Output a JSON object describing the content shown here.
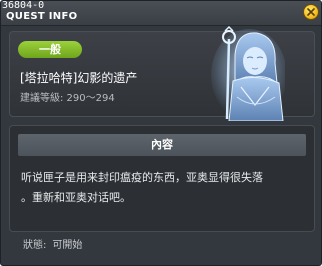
{
  "window": {
    "id_label": "36804-0",
    "title": "QUEST INFO"
  },
  "quest": {
    "category_badge": "一般",
    "name": "[塔拉哈特]幻影的遗产",
    "level_range": "建議等級: 290～294"
  },
  "content": {
    "header": "內容",
    "line1": "听说匣子是用来封印瘟疫的东西，亚奥显得很失落",
    "line2": "。重新和亚奥对话吧。"
  },
  "status": {
    "label": "狀態:",
    "value": "可開始"
  },
  "colors": {
    "badge": "#8bc34a",
    "window_bg": "#33383e",
    "close_button": "#f2bd1f"
  },
  "icons": {
    "close": "close-icon",
    "npc": "npc-portrait"
  }
}
